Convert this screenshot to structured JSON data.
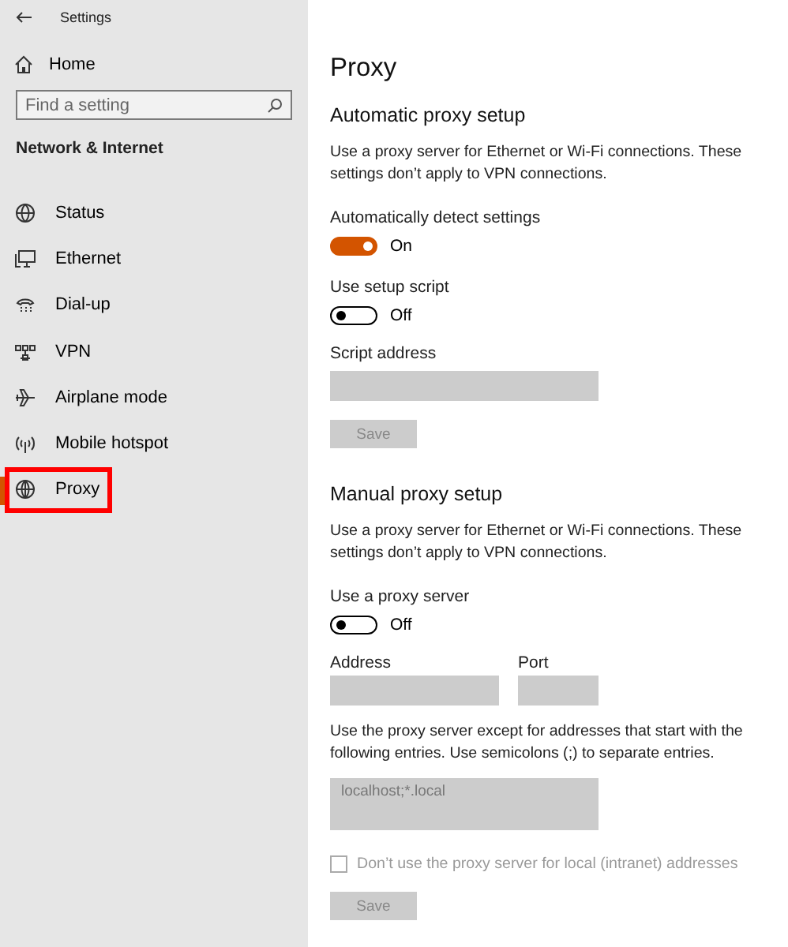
{
  "window": {
    "title": "Settings"
  },
  "sidebar": {
    "home": "Home",
    "search": {
      "placeholder": "Find a setting"
    },
    "section": "Network & Internet",
    "items": [
      {
        "label": "Status",
        "selected": false
      },
      {
        "label": "Ethernet",
        "selected": false
      },
      {
        "label": "Dial-up",
        "selected": false
      },
      {
        "label": "VPN",
        "selected": false
      },
      {
        "label": "Airplane mode",
        "selected": false
      },
      {
        "label": "Mobile hotspot",
        "selected": false
      },
      {
        "label": "Proxy",
        "selected": true
      }
    ]
  },
  "page": {
    "title": "Proxy",
    "automatic": {
      "heading": "Automatic proxy setup",
      "description": "Use a proxy server for Ethernet or Wi-Fi connections. These settings don’t apply to VPN connections.",
      "toggles": [
        {
          "label": "Automatically detect settings",
          "on": true,
          "state_text": "On"
        },
        {
          "label": "Use setup script",
          "on": false,
          "state_text": "Off"
        }
      ],
      "script_address": {
        "label": "Script address"
      },
      "save": {
        "label": "Save",
        "disabled": true
      }
    },
    "manual": {
      "heading": "Manual proxy setup",
      "description": "Use a proxy server for Ethernet or Wi-Fi connections. These settings don’t apply to VPN connections.",
      "toggle": {
        "label": "Use a proxy server",
        "on": false,
        "state_text": "Off"
      },
      "address": {
        "label": "Address"
      },
      "port": {
        "label": "Port"
      },
      "exceptions": {
        "description": "Use the proxy server except for addresses that start with the following entries. Use semicolons (;) to separate entries.",
        "value": "localhost;*.local"
      },
      "local_checkbox": {
        "label": "Don’t use the proxy server for local (intranet) addresses",
        "checked": false,
        "disabled": true
      },
      "save": {
        "label": "Save",
        "disabled": true
      }
    }
  }
}
